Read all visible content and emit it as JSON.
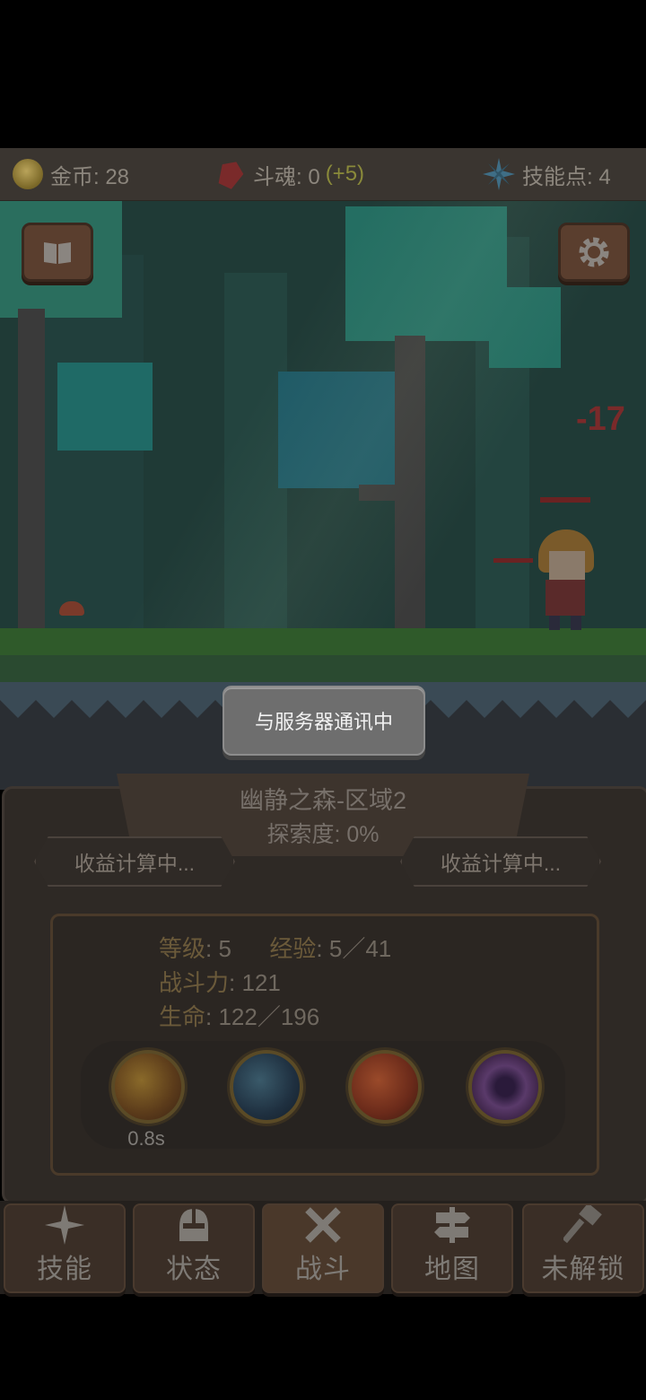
{
  "top_bar": {
    "gold_label": "金币: 28",
    "soul_label": "斗魂: 0",
    "soul_bonus": "(+5)",
    "skill_points_label": "技能点: 4"
  },
  "scene": {
    "damage_text": "-17",
    "book_icon": "book-icon",
    "settings_icon": "gear-icon"
  },
  "dialog": {
    "message": "与服务器通讯中"
  },
  "zone": {
    "name": "幽静之森-区域2",
    "exploration": "探索度: 0%",
    "left_tag": "收益计算中...",
    "right_tag": "收益计算中..."
  },
  "hero": {
    "level_label": "等级",
    "level_value": ": 5",
    "exp_label": "经验",
    "exp_value": ": 5／41",
    "power_label": "战斗力",
    "power_value": ": 121",
    "hp_label": "生命",
    "hp_value": ": 122／196",
    "skill_cooldown": "0.8s"
  },
  "skills": [
    {
      "icon": "fire-orb-icon",
      "color": "#7a5020"
    },
    {
      "icon": "blue-slash-icon",
      "color": "#203a4a"
    },
    {
      "icon": "flame-slash-icon",
      "color": "#7a3820"
    },
    {
      "icon": "vortex-icon",
      "color": "#4a2a5a"
    }
  ],
  "nav": [
    {
      "label": "技能",
      "icon": "sparkle-icon"
    },
    {
      "label": "状态",
      "icon": "helmet-icon"
    },
    {
      "label": "战斗",
      "icon": "crossed-swords-icon"
    },
    {
      "label": "地图",
      "icon": "signpost-icon"
    },
    {
      "label": "未解锁",
      "icon": "hammer-icon"
    }
  ]
}
